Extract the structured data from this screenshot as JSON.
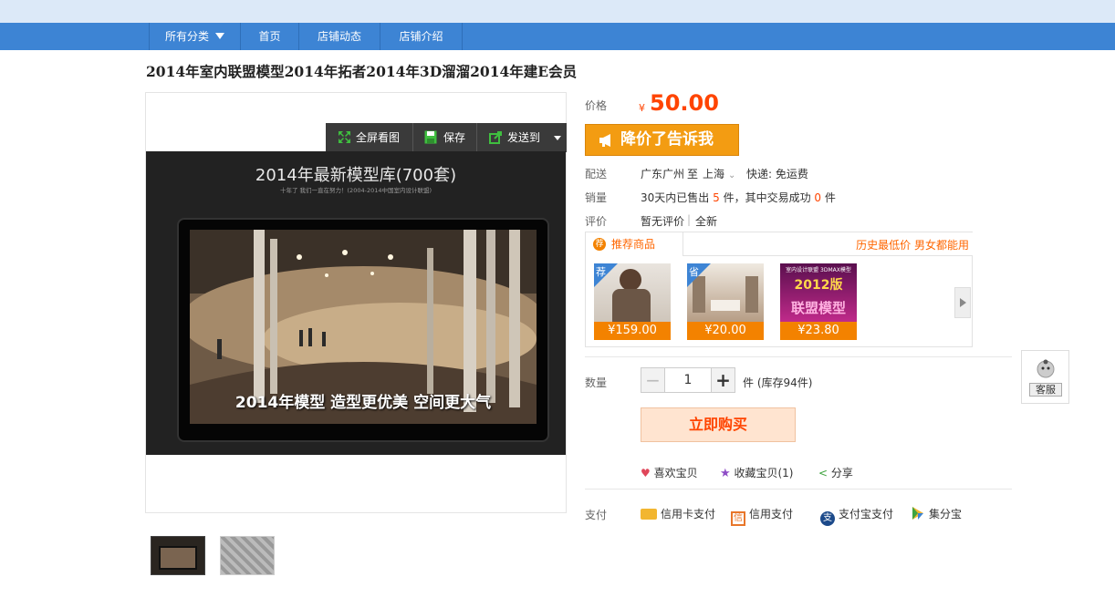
{
  "nav": {
    "items": [
      {
        "label": "所有分类"
      },
      {
        "label": "首页"
      },
      {
        "label": "店铺动态"
      },
      {
        "label": "店铺介绍"
      }
    ]
  },
  "product": {
    "title": "2014年室内联盟模型2014年拓者2014年3D溜溜2014年建E会员",
    "image": {
      "headline": "2014年最新模型库(700套)",
      "subline": "十年了 我们一直在努力！(2004-2014中国室内设计联盟)",
      "banner": "2014年模型 造型更优美 空间更大气"
    },
    "toolbar": {
      "fullscreen": "全屏看图",
      "save": "保存",
      "send": "发送到"
    }
  },
  "price": {
    "label": "价格",
    "currency": "¥",
    "value": "50.00",
    "alert_button": "降价了告诉我"
  },
  "delivery": {
    "label": "配送",
    "from": "广东广州",
    "to_word": "至",
    "to": "上海",
    "shipping": "快递: 免运费"
  },
  "sales": {
    "label": "销量",
    "prefix": "30天内已售出",
    "sold": "5",
    "mid": "件，其中交易成功",
    "success": "0",
    "suffix": "件"
  },
  "review": {
    "label": "评价",
    "value": "暂无评价",
    "sep": "|",
    "condition": "全新"
  },
  "recommend": {
    "tab": "推荐商品",
    "slogan": "历史最低价 男女都能用",
    "items": [
      {
        "badge": "荐",
        "price": "¥159.00"
      },
      {
        "badge": "省",
        "price": "¥20.00"
      },
      {
        "badge": "",
        "price": "¥23.80",
        "img_text": "2012版",
        "img_text2": "联盟模型",
        "img_top": "室内设计联盟 3DMAX模型"
      }
    ]
  },
  "quantity": {
    "label": "数量",
    "value": "1",
    "minus": "−",
    "plus": "+",
    "unit": "件 (库存94件)"
  },
  "buy_button": "立即购买",
  "actions": {
    "like": "喜欢宝贝",
    "favorite": "收藏宝贝(1)",
    "share": "分享"
  },
  "payment": {
    "label": "支付",
    "methods": [
      "信用卡支付",
      "信用支付",
      "支付宝支付",
      "集分宝"
    ]
  },
  "service": {
    "label": "客服"
  },
  "colors": {
    "nav": "#3d84d4",
    "price": "#ff4400",
    "alert": "#f39c12",
    "recommend_price": "#f38200"
  }
}
